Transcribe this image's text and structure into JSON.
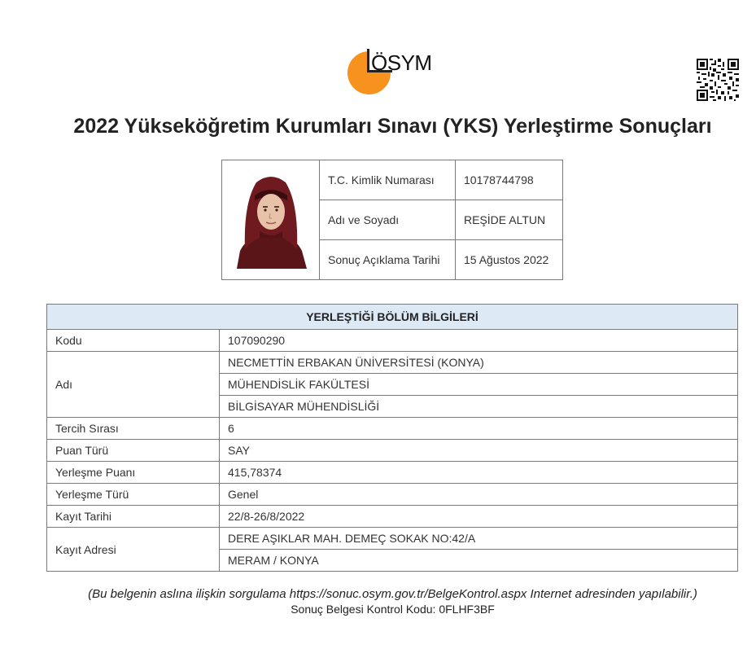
{
  "header": {
    "logo_text": "ÖSYM",
    "logo_color": "#f7921e",
    "qr_icon": "qr-code-icon",
    "title": "2022 Yükseköğretim Kurumları Sınavı (YKS) Yerleştirme Sonuçları"
  },
  "person": {
    "photo_icon": "portrait-photo",
    "rows": [
      {
        "label": "T.C. Kimlik Numarası",
        "value": "10178744798"
      },
      {
        "label": "Adı ve Soyadı",
        "value": "REŞİDE ALTUN"
      },
      {
        "label": "Sonuç Açıklama Tarihi",
        "value": "15 Ağustos 2022"
      }
    ]
  },
  "placement": {
    "heading": "YERLEŞTİĞİ BÖLÜM BİLGİLERİ",
    "heading_bg": "#dde9f5",
    "kodu_label": "Kodu",
    "kodu": "107090290",
    "adi_label": "Adı",
    "adi": [
      "NECMETTİN ERBAKAN ÜNİVERSİTESİ (KONYA)",
      "MÜHENDİSLİK FAKÜLTESİ",
      "BİLGİSAYAR MÜHENDİSLİĞİ"
    ],
    "tercih_label": "Tercih Sırası",
    "tercih": "6",
    "puan_turu_label": "Puan Türü",
    "puan_turu": "SAY",
    "puan_label": "Yerleşme Puanı",
    "puan": "415,78374",
    "yerlesme_turu_label": "Yerleşme Türü",
    "yerlesme_turu": "Genel",
    "kayit_tarihi_label": "Kayıt Tarihi",
    "kayit_tarihi": "22/8-26/8/2022",
    "kayit_adresi_label": "Kayıt Adresi",
    "kayit_adresi": [
      "DERE AŞIKLAR MAH. DEMEÇ SOKAK NO:42/A",
      "MERAM / KONYA"
    ]
  },
  "footer": {
    "note": "(Bu belgenin aslına ilişkin sorgulama https://sonuc.osym.gov.tr/BelgeKontrol.aspx Internet adresinden yapılabilir.)",
    "code": "Sonuç Belgesi Kontrol Kodu: 0FLHF3BF"
  }
}
